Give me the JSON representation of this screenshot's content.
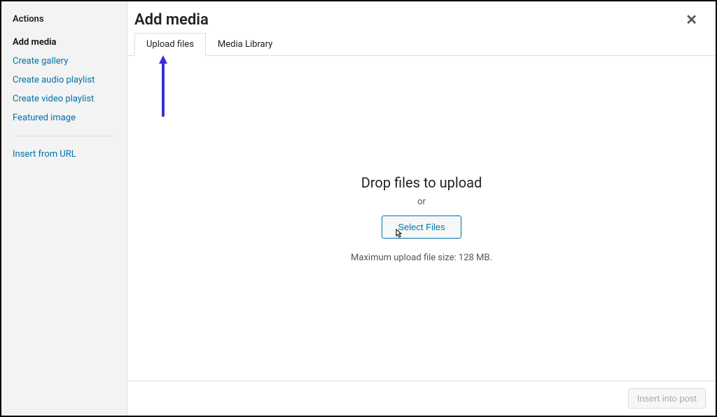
{
  "sidebar": {
    "title": "Actions",
    "items": [
      {
        "label": "Add media",
        "active": true
      },
      {
        "label": "Create gallery"
      },
      {
        "label": "Create audio playlist"
      },
      {
        "label": "Create video playlist"
      },
      {
        "label": "Featured image"
      }
    ],
    "secondary": [
      {
        "label": "Insert from URL"
      }
    ]
  },
  "header": {
    "title": "Add media"
  },
  "tabs": [
    {
      "label": "Upload files",
      "active": true
    },
    {
      "label": "Media Library"
    }
  ],
  "upload": {
    "drop_title": "Drop files to upload",
    "or_label": "or",
    "select_label": "Select Files",
    "max_size": "Maximum upload file size: 128 MB."
  },
  "footer": {
    "insert_label": "Insert into post"
  }
}
